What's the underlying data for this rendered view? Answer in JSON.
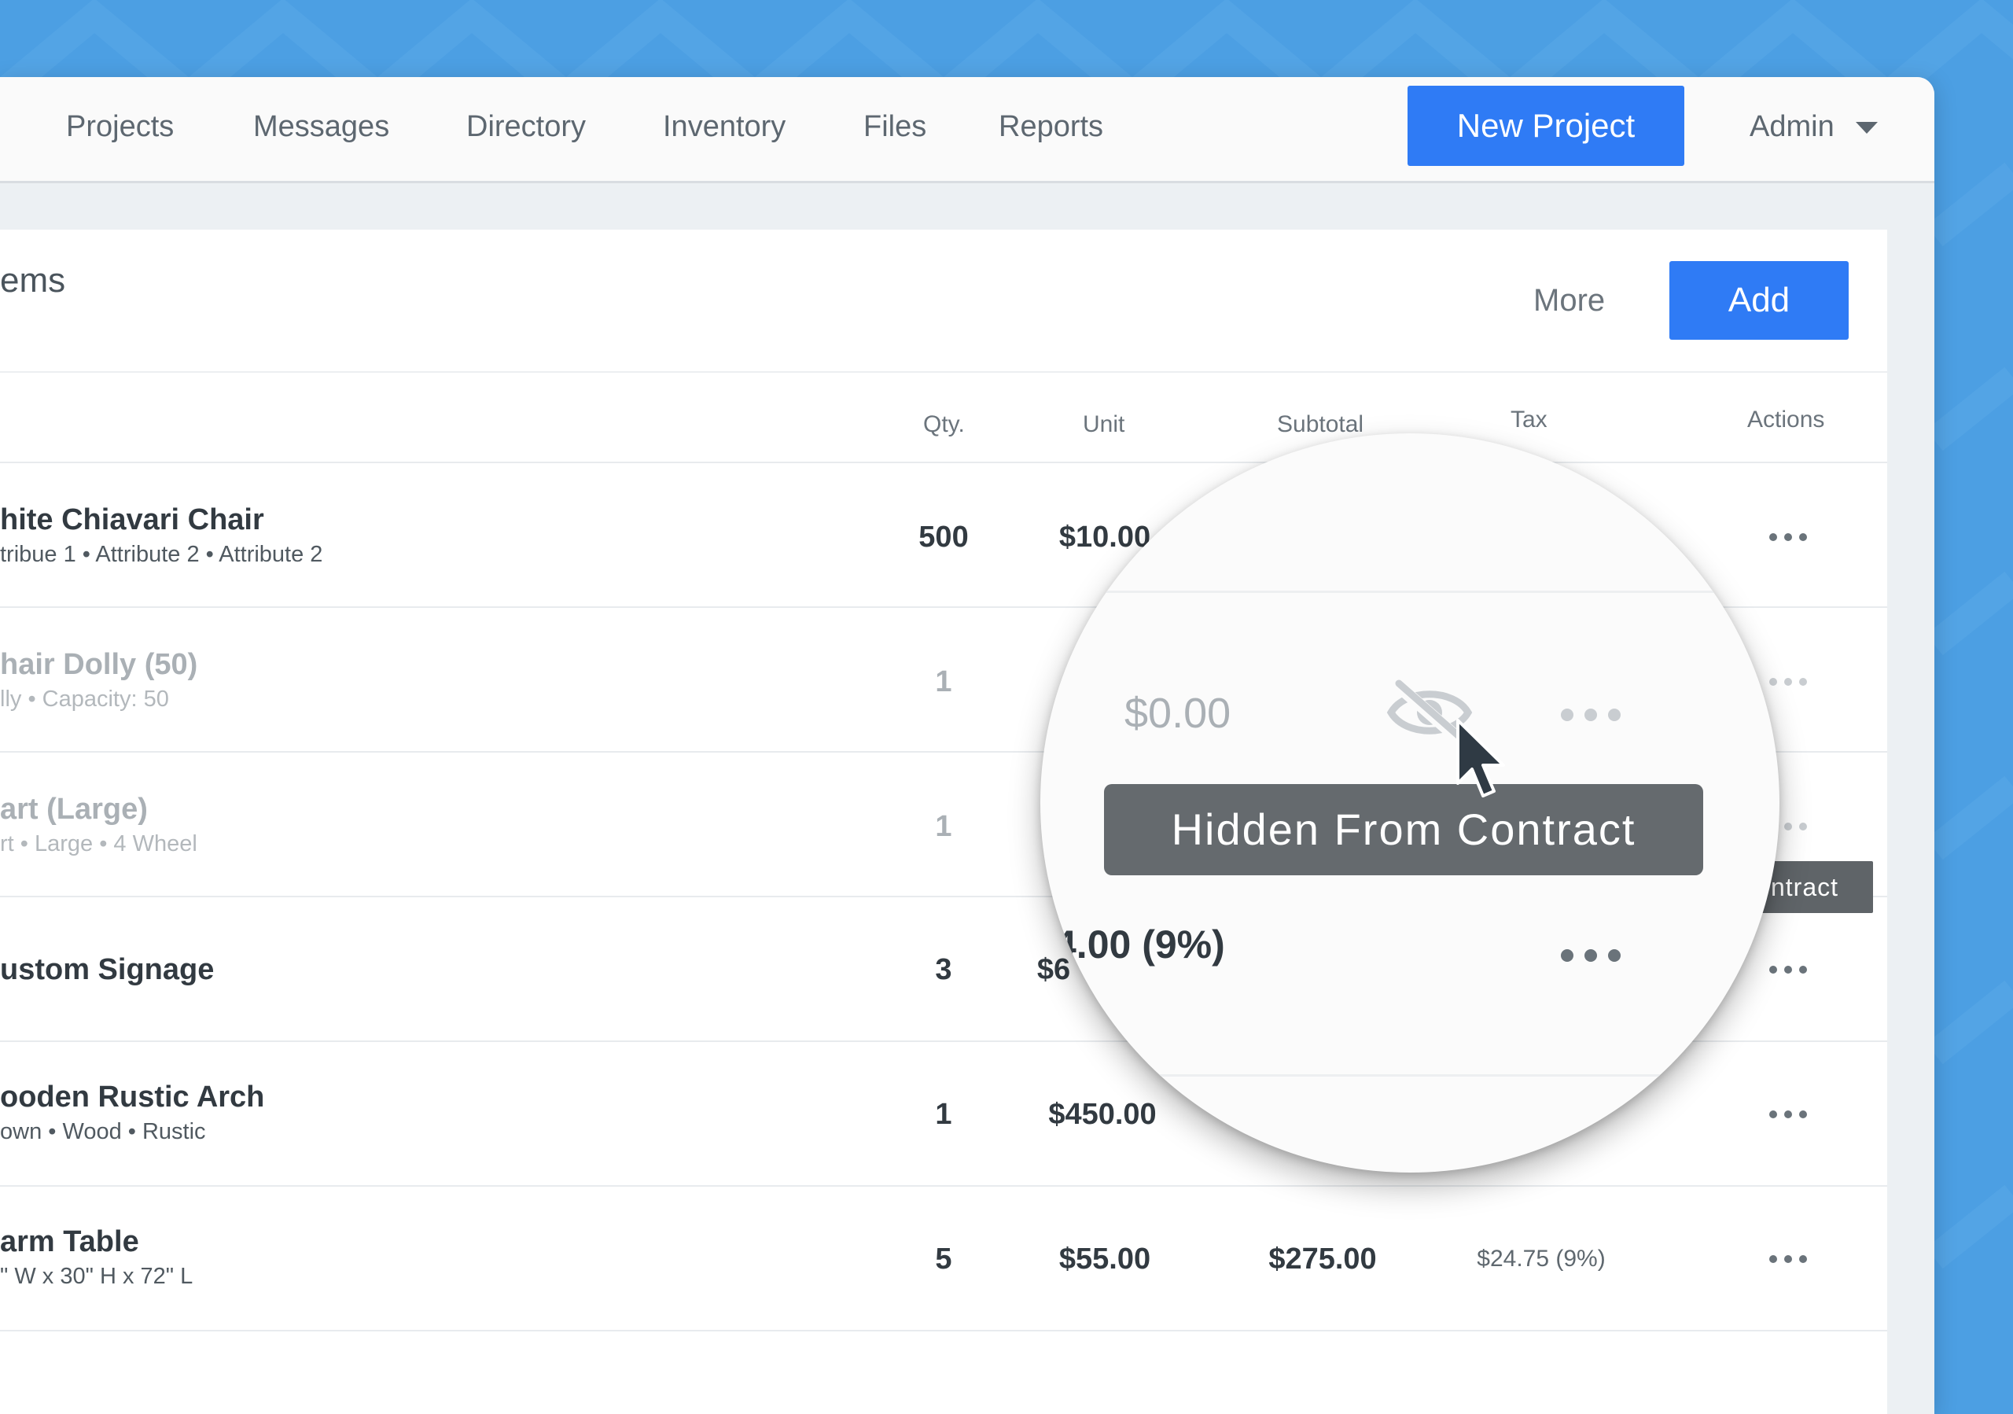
{
  "nav": {
    "items": [
      "Projects",
      "Messages",
      "Directory",
      "Inventory",
      "Files",
      "Reports"
    ],
    "new_project": "New Project",
    "admin": "Admin"
  },
  "panel": {
    "title": "ems",
    "more": "More",
    "add": "Add",
    "columns": {
      "qty": "Qty.",
      "unit": "Unit",
      "subtotal": "Subtotal",
      "tax": "Tax",
      "actions": "Actions"
    }
  },
  "rows": [
    {
      "name": "hite Chiavari Chair",
      "sub": "tribue 1  •  Attribute 2  •  Attribute 2",
      "qty": "500",
      "unit": "$10.00",
      "subtotal": "",
      "tax": ""
    },
    {
      "name": "hair Dolly (50)",
      "sub": "lly • Capacity: 50",
      "qty": "1",
      "unit": "",
      "subtotal": "",
      "tax": ""
    },
    {
      "name": "art (Large)",
      "sub": "rt • Large • 4 Wheel",
      "qty": "1",
      "unit": "",
      "subtotal": "",
      "tax": ""
    },
    {
      "name": "ustom Signage",
      "sub": "",
      "qty": "3",
      "unit": "$6",
      "subtotal": "",
      "tax": ""
    },
    {
      "name": "ooden Rustic Arch",
      "sub": "own • Wood • Rustic",
      "qty": "1",
      "unit": "$450.00",
      "subtotal": "",
      "tax": ""
    },
    {
      "name": "arm Table",
      "sub": "\" W x 30\" H x 72\" L",
      "qty": "5",
      "unit": "$55.00",
      "subtotal": "$275.00",
      "tax": "$24.75 (9%)"
    }
  ],
  "tooltip_behind": "ntract",
  "magnifier": {
    "price": "$0.00",
    "tax": "4.00 (9%)",
    "tooltip": "Hidden From Contract",
    "icon": "eye-slash-icon"
  },
  "icons": [
    "caret-down-icon",
    "more-dots-icon",
    "eye-slash-icon",
    "cursor-icon"
  ],
  "colors": {
    "background": "#4c9fe3",
    "primary": "#2f7bf5",
    "tooltip": "#656a6e"
  }
}
